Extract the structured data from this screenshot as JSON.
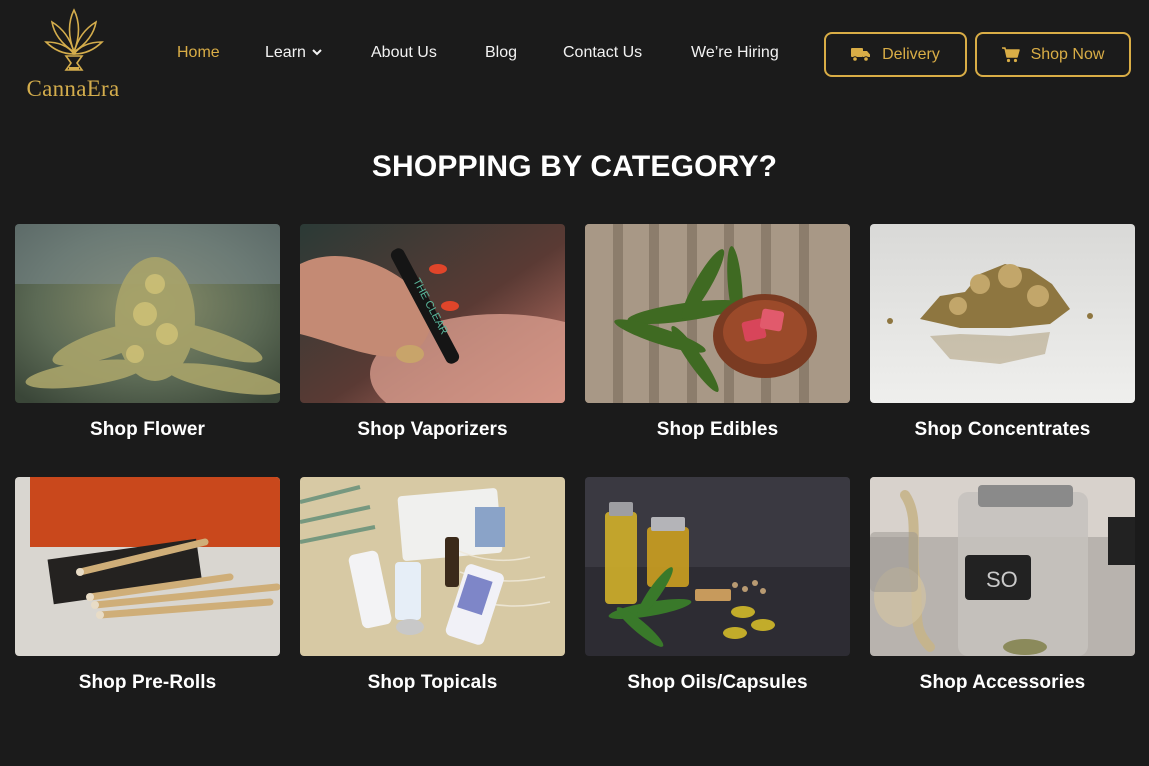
{
  "brand": {
    "name": "CannaEra",
    "accent": "#d9ad46",
    "background": "#1b1b1b"
  },
  "nav": {
    "items": [
      {
        "label": "Home",
        "active": true
      },
      {
        "label": "Learn",
        "has_dropdown": true
      },
      {
        "label": "About Us"
      },
      {
        "label": "Blog"
      },
      {
        "label": "Contact Us"
      },
      {
        "label": "We’re Hiring"
      }
    ]
  },
  "actions": {
    "delivery": {
      "label": "Delivery",
      "icon": "truck-icon"
    },
    "shop_now": {
      "label": "Shop Now",
      "icon": "cart-icon"
    }
  },
  "section": {
    "title": "SHOPPING BY CATEGORY?"
  },
  "categories": [
    {
      "label": "Shop Flower",
      "image": "cannabis-bud-photo"
    },
    {
      "label": "Shop Vaporizers",
      "image": "vape-pen-photo",
      "image_text": "THE CLEAR"
    },
    {
      "label": "Shop Edibles",
      "image": "gummies-on-wooden-plate-photo"
    },
    {
      "label": "Shop Concentrates",
      "image": "concentrate-crumble-photo"
    },
    {
      "label": "Shop Pre-Rolls",
      "image": "pre-rolls-photo"
    },
    {
      "label": "Shop Topicals",
      "image": "topical-products-photo"
    },
    {
      "label": "Shop Oils/Capsules",
      "image": "oil-bottles-and-capsules-photo"
    },
    {
      "label": "Shop Accessories",
      "image": "glass-jars-and-pipe-photo"
    }
  ]
}
